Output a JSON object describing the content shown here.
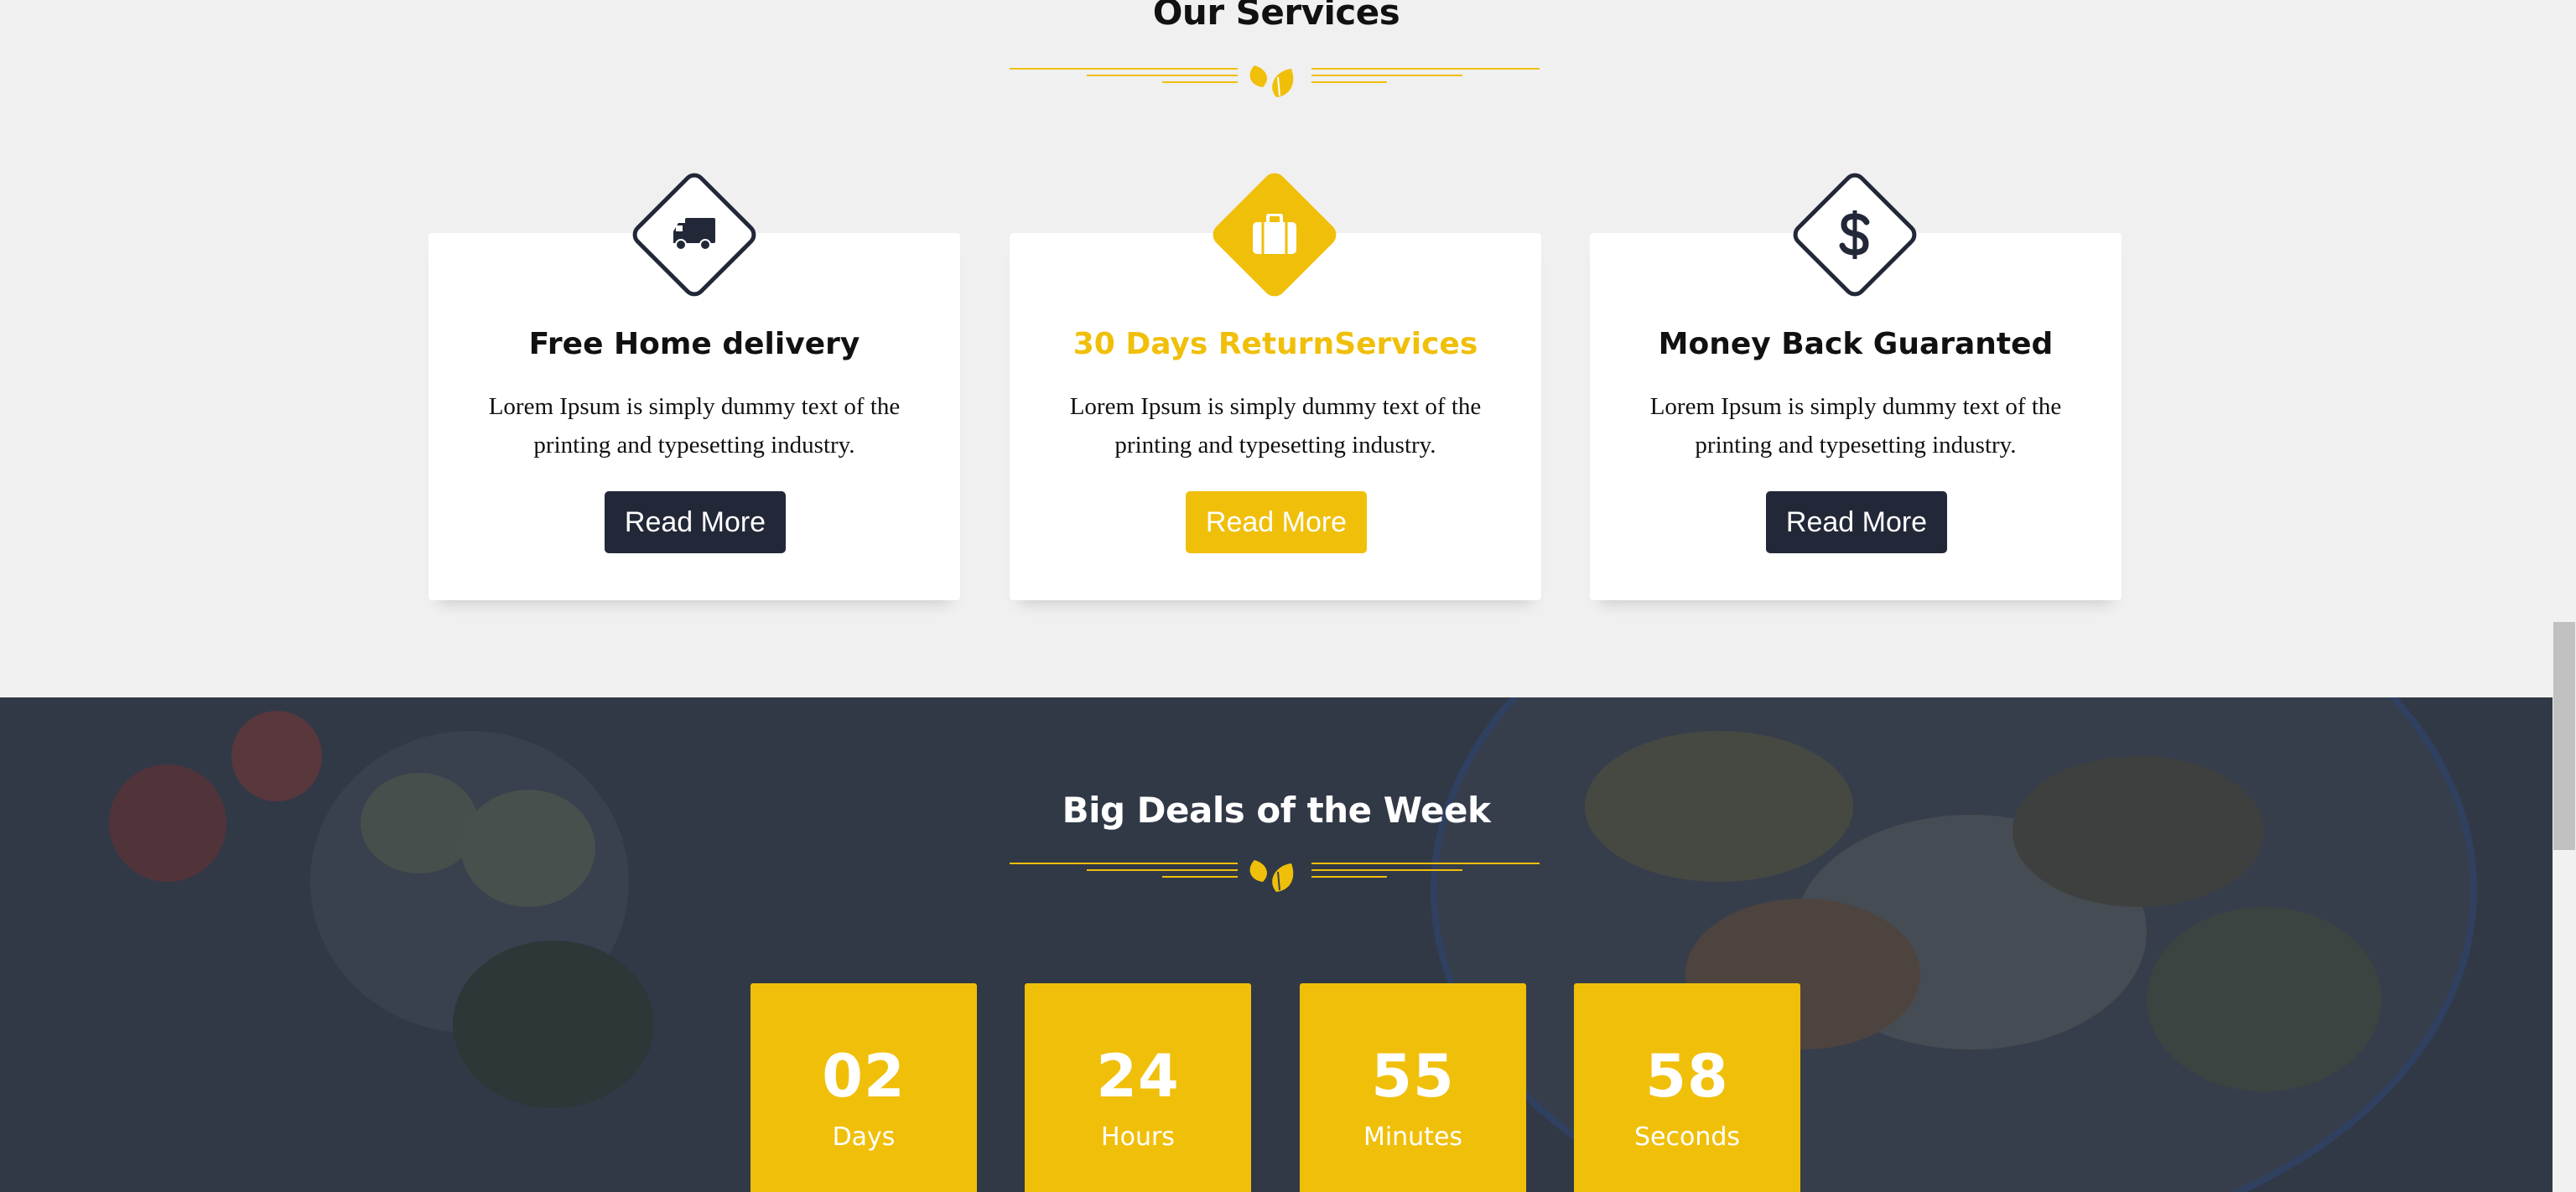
{
  "services": {
    "title": "Our Services",
    "cards": [
      {
        "icon": "truck-icon",
        "title": "Free Home delivery",
        "text": "Lorem Ipsum is simply dummy text of the printing and typesetting industry.",
        "button": "Read More"
      },
      {
        "icon": "briefcase-icon",
        "title": "30 Days ReturnServices",
        "text": "Lorem Ipsum is simply dummy text of the printing and typesetting industry.",
        "button": "Read More"
      },
      {
        "icon": "dollar-icon",
        "title": "Money Back Guaranted",
        "text": "Lorem Ipsum is simply dummy text of the printing and typesetting industry.",
        "button": "Read More"
      }
    ]
  },
  "deals": {
    "title": "Big Deals of the Week",
    "countdown": [
      {
        "value": "02",
        "label": "Days"
      },
      {
        "value": "24",
        "label": "Hours"
      },
      {
        "value": "55",
        "label": "Minutes"
      },
      {
        "value": "58",
        "label": "Seconds"
      }
    ]
  },
  "colors": {
    "accent": "#f0bf0a",
    "dark": "#222838",
    "deals_bg": "#39414f",
    "page_bg": "#f0f0f0"
  }
}
